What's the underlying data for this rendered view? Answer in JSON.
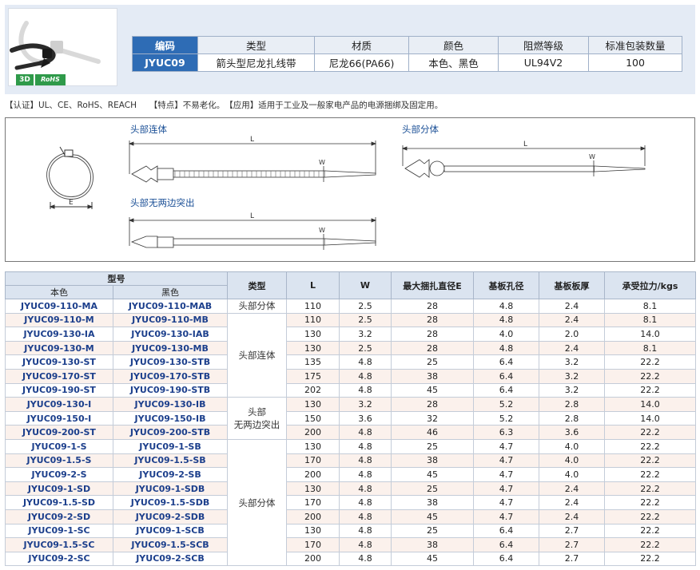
{
  "product": {
    "badges": {
      "three_d": "3D",
      "rohs": "RoHS"
    }
  },
  "summary": {
    "headers": [
      "编码",
      "类型",
      "材质",
      "颜色",
      "阻燃等级",
      "标准包装数量"
    ],
    "values": [
      "JYUC09",
      "箭头型尼龙扎线带",
      "尼龙66(PA66)",
      "本色、黑色",
      "UL94V2",
      "100"
    ]
  },
  "info_line": "【认证】UL、CE、RoHS、REACH　　【特点】不易老化。　【应用】适用于工业及一般家电产品的电源捆绑及固定用。",
  "drawings": {
    "head_connected": "头部连体",
    "head_separate": "头部分体",
    "head_no_protrusion": "头部无两边突出",
    "dim_L": "L",
    "dim_W": "W",
    "dim_E": "E"
  },
  "table": {
    "group_header": "型号",
    "headers": {
      "natural": "本色",
      "black": "黑色",
      "type": "类型",
      "L": "L",
      "W": "W",
      "max_dia": "最大捆扎直径E",
      "hole": "基板孔径",
      "thickness": "基板板厚",
      "tensile": "承受拉力/kgs"
    },
    "types": [
      "头部分体",
      "头部连体",
      "头部\n无两边突出",
      "头部分体"
    ],
    "rows": [
      [
        "JYUC09-110-MA",
        "JYUC09-110-MAB",
        "110",
        "2.5",
        "28",
        "4.8",
        "2.4",
        "8.1"
      ],
      [
        "JYUC09-110-M",
        "JYUC09-110-MB",
        "110",
        "2.5",
        "28",
        "4.8",
        "2.4",
        "8.1"
      ],
      [
        "JYUC09-130-IA",
        "JYUC09-130-IAB",
        "130",
        "3.2",
        "28",
        "4.0",
        "2.0",
        "14.0"
      ],
      [
        "JYUC09-130-M",
        "JYUC09-130-MB",
        "130",
        "2.5",
        "28",
        "4.8",
        "2.4",
        "8.1"
      ],
      [
        "JYUC09-130-ST",
        "JYUC09-130-STB",
        "135",
        "4.8",
        "25",
        "6.4",
        "3.2",
        "22.2"
      ],
      [
        "JYUC09-170-ST",
        "JYUC09-170-STB",
        "175",
        "4.8",
        "38",
        "6.4",
        "3.2",
        "22.2"
      ],
      [
        "JYUC09-190-ST",
        "JYUC09-190-STB",
        "202",
        "4.8",
        "45",
        "6.4",
        "3.2",
        "22.2"
      ],
      [
        "JYUC09-130-I",
        "JYUC09-130-IB",
        "130",
        "3.2",
        "28",
        "5.2",
        "2.8",
        "14.0"
      ],
      [
        "JYUC09-150-I",
        "JYUC09-150-IB",
        "150",
        "3.6",
        "32",
        "5.2",
        "2.8",
        "14.0"
      ],
      [
        "JYUC09-200-ST",
        "JYUC09-200-STB",
        "200",
        "4.8",
        "46",
        "6.3",
        "3.6",
        "22.2"
      ],
      [
        "JYUC09-1-S",
        "JYUC09-1-SB",
        "130",
        "4.8",
        "25",
        "4.7",
        "4.0",
        "22.2"
      ],
      [
        "JYUC09-1.5-S",
        "JYUC09-1.5-SB",
        "170",
        "4.8",
        "38",
        "4.7",
        "4.0",
        "22.2"
      ],
      [
        "JYUC09-2-S",
        "JYUC09-2-SB",
        "200",
        "4.8",
        "45",
        "4.7",
        "4.0",
        "22.2"
      ],
      [
        "JYUC09-1-SD",
        "JYUC09-1-SDB",
        "130",
        "4.8",
        "25",
        "4.7",
        "2.4",
        "22.2"
      ],
      [
        "JYUC09-1.5-SD",
        "JYUC09-1.5-SDB",
        "170",
        "4.8",
        "38",
        "4.7",
        "2.4",
        "22.2"
      ],
      [
        "JYUC09-2-SD",
        "JYUC09-2-SDB",
        "200",
        "4.8",
        "45",
        "4.7",
        "2.4",
        "22.2"
      ],
      [
        "JYUC09-1-SC",
        "JYUC09-1-SCB",
        "130",
        "4.8",
        "25",
        "6.4",
        "2.7",
        "22.2"
      ],
      [
        "JYUC09-1.5-SC",
        "JYUC09-1.5-SCB",
        "170",
        "4.8",
        "38",
        "6.4",
        "2.7",
        "22.2"
      ],
      [
        "JYUC09-2-SC",
        "JYUC09-2-SCB",
        "200",
        "4.8",
        "45",
        "6.4",
        "2.7",
        "22.2"
      ]
    ]
  },
  "colors": {
    "brand_blue": "#2e6cb5",
    "header_band": "#e4ebf5",
    "alt_row": "#fbf1ec",
    "model_text": "#1c3f8c"
  }
}
